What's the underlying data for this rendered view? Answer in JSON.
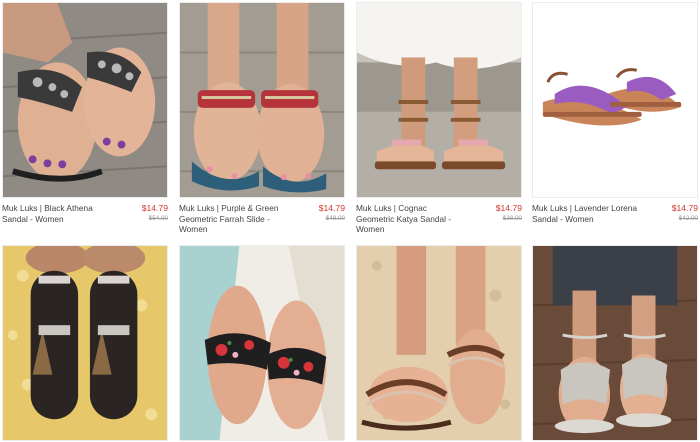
{
  "products": [
    {
      "name_line1": "Muk Luks | Black Athena",
      "name_line2": "Sandal - Women",
      "name_line3": "",
      "price": "$14.79",
      "original_price": "$54.00",
      "image_icon": "sandal-photo-black-athena"
    },
    {
      "name_line1": "Muk Luks | Purple & Green",
      "name_line2": "Geometric Farrah Slide -",
      "name_line3": "Women",
      "price": "$14.79",
      "original_price": "$48.00",
      "image_icon": "sandal-photo-farrah-slide"
    },
    {
      "name_line1": "Muk Luks | Cognac",
      "name_line2": "Geometric Katya Sandal -",
      "name_line3": "Women",
      "price": "$14.79",
      "original_price": "$38.00",
      "image_icon": "sandal-photo-katya"
    },
    {
      "name_line1": "Muk Luks | Lavender Lorena",
      "name_line2": "Sandal - Women",
      "name_line3": "",
      "price": "$14.79",
      "original_price": "$42.00",
      "image_icon": "sandal-photo-lorena"
    },
    {
      "image_icon": "sandal-photo-tassel-black"
    },
    {
      "image_icon": "sandal-photo-floral-slide"
    },
    {
      "image_icon": "sandal-photo-beaded-thong"
    },
    {
      "image_icon": "sandal-photo-silver-sandal"
    }
  ],
  "colors": {
    "sale_price": "#d0342c",
    "original_price": "#999999",
    "name_text": "#444444"
  }
}
